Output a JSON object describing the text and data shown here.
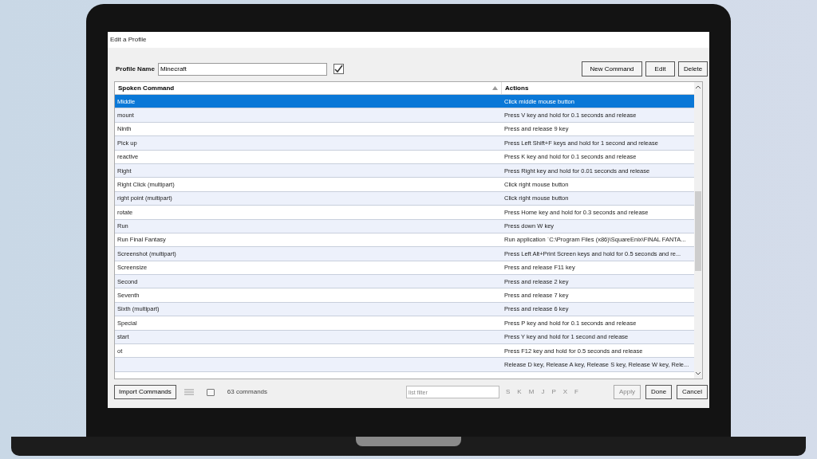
{
  "window": {
    "title": "Edit a Profile"
  },
  "profile": {
    "label": "Profile Name",
    "value": "Minecraft",
    "checked": true
  },
  "toolbar_buttons": [
    "New Command",
    "Edit",
    "Delete"
  ],
  "table": {
    "columns": [
      {
        "label": "Spoken Command",
        "sorted": true
      },
      {
        "label": "Actions"
      }
    ],
    "rows": [
      {
        "command": "Middle",
        "action": "Click middle mouse button",
        "selected": true
      },
      {
        "command": "mount",
        "action": "Press V key and hold for 0.1 seconds and release",
        "selected": false
      },
      {
        "command": "Ninth",
        "action": "Press and release 9 key",
        "selected": false
      },
      {
        "command": "Pick up",
        "action": "Press Left Shift+F keys and hold for 1 second and release",
        "selected": false
      },
      {
        "command": "reactive",
        "action": "Press K key and hold for 0.1 seconds and release",
        "selected": false
      },
      {
        "command": "Right",
        "action": "Press Right key and hold for 0.01 seconds and release",
        "selected": false
      },
      {
        "command": "Right Click (multipart)",
        "action": "Click right mouse button",
        "selected": false
      },
      {
        "command": "right point (multipart)",
        "action": "Click right mouse button",
        "selected": false
      },
      {
        "command": "rotate",
        "action": "Press Home key and hold for 0.3 seconds and release",
        "selected": false
      },
      {
        "command": "Run",
        "action": "Press down W key",
        "selected": false
      },
      {
        "command": "Run Final Fantasy",
        "action": "Run application `C:\\Program Files (x86)\\SquareEnix\\FINAL FANTA...",
        "selected": false
      },
      {
        "command": "Screenshot (multipart)",
        "action": "Press Left Alt+Print Screen keys and hold for 0.5 seconds and re...",
        "selected": false
      },
      {
        "command": "Screensize",
        "action": "Press and release F11 key",
        "selected": false
      },
      {
        "command": "Second",
        "action": "Press and release 2 key",
        "selected": false
      },
      {
        "command": "Seventh",
        "action": "Press and release 7 key",
        "selected": false
      },
      {
        "command": "Sixth (multipart)",
        "action": "Press and release 6 key",
        "selected": false
      },
      {
        "command": "Special",
        "action": "Press P key and hold for 0.1 seconds and release",
        "selected": false
      },
      {
        "command": "start",
        "action": "Press Y key and hold for 1 second and release",
        "selected": false
      },
      {
        "command": "ot",
        "action": "Press F12 key and hold for 0.5 seconds and release",
        "selected": false
      },
      {
        "action": "Release D key, Release A key, Release S key, Release W key, Rele...",
        "selected": false
      }
    ]
  },
  "footer": {
    "import_button": "Import Commands",
    "view_checkbox": {
      "checked": false
    },
    "count": "63 commands",
    "filter_placeholder": "list filter",
    "letters": [
      {
        "label": "S",
        "disabled": true
      },
      {
        "label": "K",
        "disabled": true
      },
      {
        "label": "M",
        "disabled": true
      },
      {
        "label": "J",
        "disabled": true
      },
      {
        "label": "P",
        "disabled": true
      },
      {
        "label": "X",
        "disabled": true
      },
      {
        "label": "F",
        "disabled": true
      }
    ],
    "buttons": [
      {
        "label": "Apply",
        "disabled": true
      },
      {
        "label": "Done",
        "disabled": false
      },
      {
        "label": "Cancel",
        "disabled": false
      }
    ]
  }
}
